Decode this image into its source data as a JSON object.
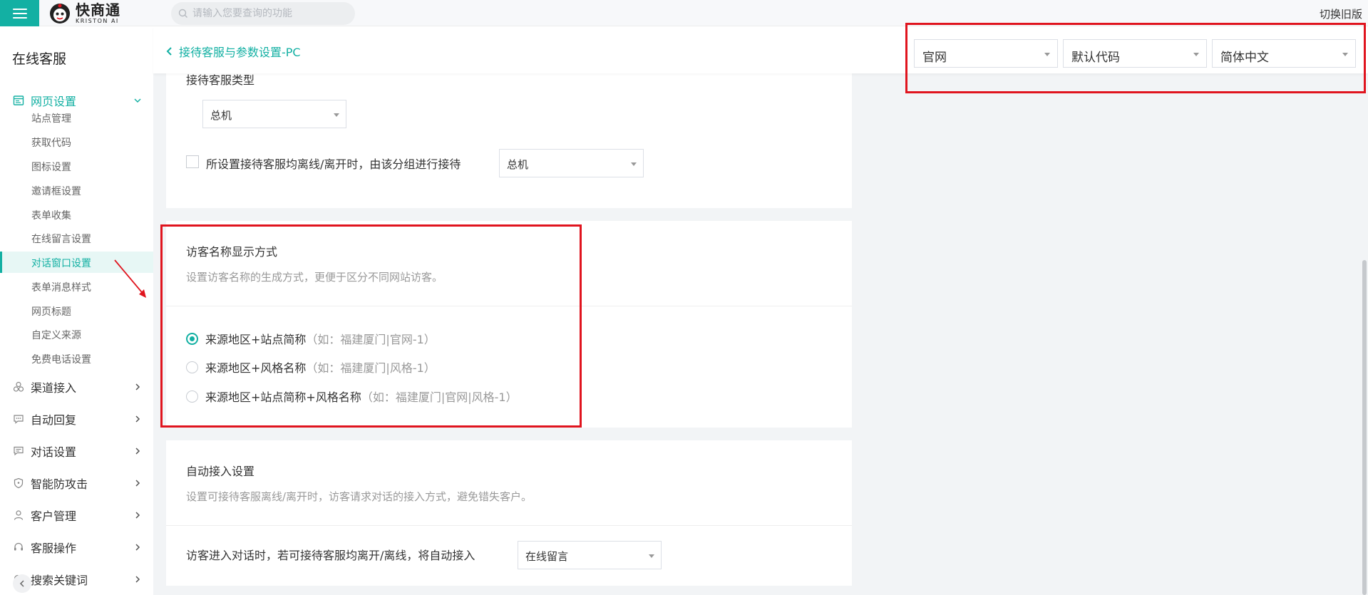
{
  "topbar": {
    "brand_cn": "快商通",
    "brand_en": "KRISTON AI",
    "search_placeholder": "请输入您要查询的功能",
    "switch_old": "切换旧版"
  },
  "sidebar": {
    "title": "在线客服",
    "groups": [
      {
        "label": "网页设置",
        "icon": "webpage-icon",
        "expanded": true
      },
      {
        "label": "渠道接入",
        "icon": "channels-icon"
      },
      {
        "label": "自动回复",
        "icon": "chat-bubble-icon"
      },
      {
        "label": "对话设置",
        "icon": "dialog-icon"
      },
      {
        "label": "智能防攻击",
        "icon": "shield-icon"
      },
      {
        "label": "客户管理",
        "icon": "user-icon"
      },
      {
        "label": "客服操作",
        "icon": "headset-icon"
      },
      {
        "label": "搜索关键词",
        "icon": "search-icon"
      }
    ],
    "subitems": [
      "站点管理",
      "获取代码",
      "图标设置",
      "邀请框设置",
      "表单收集",
      "在线留言设置",
      "对话窗口设置",
      "表单消息样式",
      "网页标题",
      "自定义来源",
      "免费电话设置"
    ],
    "active_subitem": "对话窗口设置"
  },
  "header": {
    "back_label": "接待客服与参数设置-PC",
    "selects": [
      "官网",
      "默认代码",
      "简体中文"
    ]
  },
  "reception": {
    "type_label": "接待客服类型",
    "type_value": "总机",
    "fallback_label": "所设置接待客服均离线/离开时，由该分组进行接待",
    "fallback_value": "总机"
  },
  "visitor_name": {
    "title": "访客名称显示方式",
    "desc": "设置访客名称的生成方式，更便于区分不同网站访客。",
    "options": [
      {
        "label": "来源地区+站点简称",
        "hint": "（如：福建厦门|官网-1）",
        "checked": true
      },
      {
        "label": "来源地区+风格名称",
        "hint": "（如：福建厦门|风格-1）",
        "checked": false
      },
      {
        "label": "来源地区+站点简称+风格名称",
        "hint": "（如：福建厦门|官网|风格-1）",
        "checked": false
      }
    ]
  },
  "auto_access": {
    "title": "自动接入设置",
    "desc": "设置可接待客服离线/离开时，访客请求对话的接入方式，避免错失客户。",
    "row_label": "访客进入对话时，若可接待客服均离开/离线，将自动接入",
    "row_value": "在线留言"
  },
  "colors": {
    "accent": "#13b0a3",
    "annotation": "#e0141e"
  }
}
